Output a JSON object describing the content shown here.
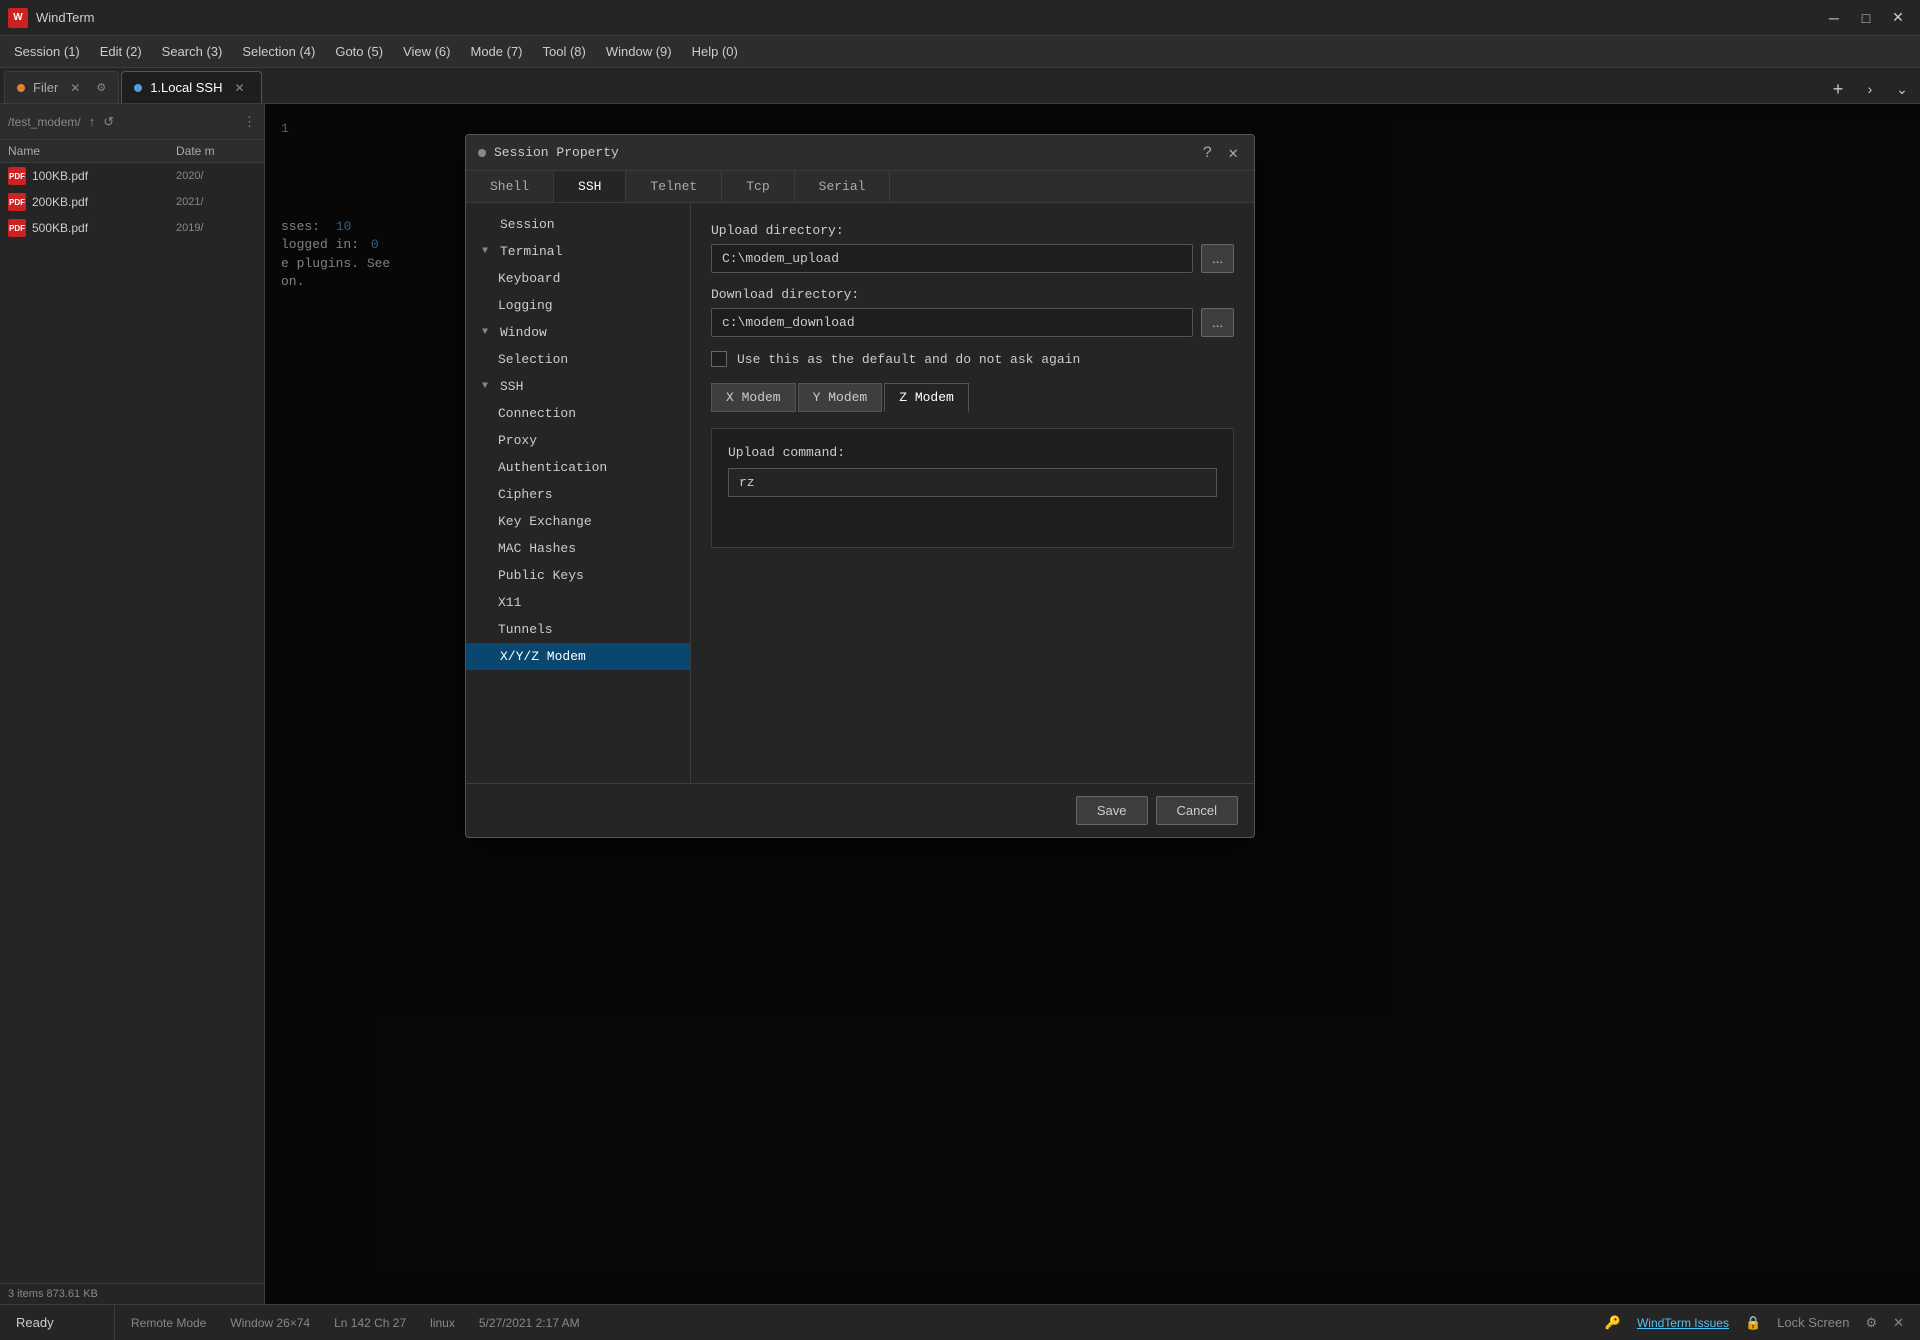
{
  "app": {
    "title": "WindTerm",
    "logo": "W"
  },
  "window_controls": {
    "minimize": "─",
    "maximize": "□",
    "close": "✕"
  },
  "menu": {
    "items": [
      "Session (1)",
      "Edit (2)",
      "Search (3)",
      "Selection (4)",
      "Goto (5)",
      "View (6)",
      "Mode (7)",
      "Tool (8)",
      "Window (9)",
      "Help (0)"
    ]
  },
  "tabs": [
    {
      "id": "filer",
      "label": "Filer",
      "active": false,
      "dot_color": "orange"
    },
    {
      "id": "ssh",
      "label": "1.Local SSH",
      "active": true,
      "dot_color": "blue"
    }
  ],
  "tab_actions": {
    "new": "+",
    "chevron_right": "›",
    "chevron_down": "⌄"
  },
  "file_panel": {
    "path": "/test_modem/",
    "headers": {
      "name": "Name",
      "date": "Date m"
    },
    "files": [
      {
        "name": "100KB.pdf",
        "date": "2020/"
      },
      {
        "name": "200KB.pdf",
        "date": "2021/"
      },
      {
        "name": "500KB.pdf",
        "date": "2019/"
      }
    ],
    "status": "3 items  873.61 KB"
  },
  "terminal": {
    "lines": [
      {
        "text": "sses:",
        "color": "normal",
        "value": "10",
        "value_color": "blue"
      },
      {
        "text": "logged in:",
        "color": "normal",
        "value": "0",
        "value_color": "blue"
      },
      {
        "text": "e plugins. See",
        "color": "normal"
      },
      {
        "text": "on.",
        "color": "normal"
      }
    ]
  },
  "dialog": {
    "title": "Session Property",
    "question_mark": "?",
    "tabs": [
      "Shell",
      "SSH",
      "Telnet",
      "Tcp",
      "Serial"
    ],
    "active_tab": "SSH",
    "nav": {
      "items": [
        {
          "id": "session",
          "label": "Session",
          "indent": 0,
          "arrow": ""
        },
        {
          "id": "terminal",
          "label": "Terminal",
          "indent": 0,
          "arrow": "▼"
        },
        {
          "id": "keyboard",
          "label": "Keyboard",
          "indent": 1,
          "arrow": ""
        },
        {
          "id": "logging",
          "label": "Logging",
          "indent": 1,
          "arrow": ""
        },
        {
          "id": "window",
          "label": "Window",
          "indent": 0,
          "arrow": "▼"
        },
        {
          "id": "selection",
          "label": "Selection",
          "indent": 1,
          "arrow": ""
        },
        {
          "id": "ssh",
          "label": "SSH",
          "indent": 0,
          "arrow": "▼"
        },
        {
          "id": "connection",
          "label": "Connection",
          "indent": 1,
          "arrow": ""
        },
        {
          "id": "proxy",
          "label": "Proxy",
          "indent": 1,
          "arrow": ""
        },
        {
          "id": "authentication",
          "label": "Authentication",
          "indent": 1,
          "arrow": ""
        },
        {
          "id": "ciphers",
          "label": "Ciphers",
          "indent": 1,
          "arrow": ""
        },
        {
          "id": "key-exchange",
          "label": "Key Exchange",
          "indent": 1,
          "arrow": ""
        },
        {
          "id": "mac-hashes",
          "label": "MAC Hashes",
          "indent": 1,
          "arrow": ""
        },
        {
          "id": "public-keys",
          "label": "Public Keys",
          "indent": 1,
          "arrow": ""
        },
        {
          "id": "x11",
          "label": "X11",
          "indent": 1,
          "arrow": ""
        },
        {
          "id": "tunnels",
          "label": "Tunnels",
          "indent": 1,
          "arrow": ""
        },
        {
          "id": "xyz-modem",
          "label": "X/Y/Z Modem",
          "indent": 0,
          "arrow": "",
          "selected": true
        }
      ]
    },
    "content": {
      "upload_directory_label": "Upload directory:",
      "upload_directory_value": "C:\\modem_upload",
      "download_directory_label": "Download directory:",
      "download_directory_value": "c:\\modem_download",
      "checkbox_label": "Use this as the default and do not ask again",
      "checkbox_checked": false,
      "modem_tabs": [
        "X Modem",
        "Y Modem",
        "Z Modem"
      ],
      "active_modem_tab": "Z Modem",
      "upload_command_label": "Upload command:",
      "upload_command_value": "rz",
      "browse_label": "..."
    },
    "footer": {
      "save_label": "Save",
      "cancel_label": "Cancel"
    }
  },
  "status_bar": {
    "ready_label": "Ready",
    "remote_mode": "Remote Mode",
    "window_size": "Window 26×74",
    "position": "Ln 142 Ch 27",
    "os": "linux",
    "datetime": "5/27/2021  2:17 AM",
    "windterm_issues": "WindTerm Issues",
    "lock_screen": "Lock Screen",
    "terminal_icon": "⊞",
    "gear_icon": "⚙",
    "close_icon": "✕"
  }
}
